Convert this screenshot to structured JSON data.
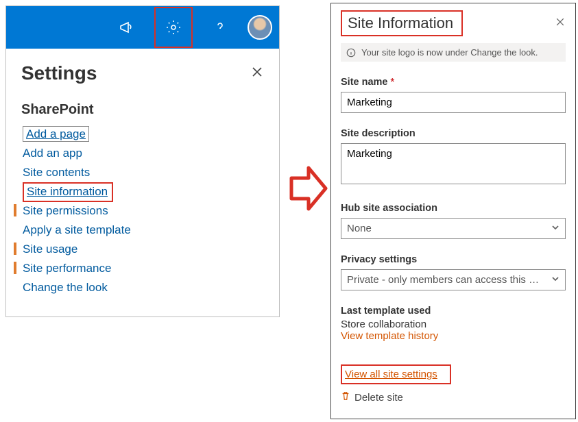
{
  "settings": {
    "title": "Settings",
    "section": "SharePoint",
    "items": [
      {
        "label": "Add a page",
        "boxed": true
      },
      {
        "label": "Add an app"
      },
      {
        "label": "Site contents"
      },
      {
        "label": "Site information",
        "highlight_red": true
      },
      {
        "label": "Site permissions",
        "orange_tick": true
      },
      {
        "label": "Apply a site template"
      },
      {
        "label": "Site usage",
        "orange_tick": true
      },
      {
        "label": "Site performance",
        "orange_tick": true
      },
      {
        "label": "Change the look"
      }
    ]
  },
  "site_info": {
    "title": "Site Information",
    "banner": "Your site logo is now under Change the look.",
    "site_name_label": "Site name",
    "site_name_value": "Marketing",
    "site_desc_label": "Site description",
    "site_desc_value": "Marketing",
    "hub_label": "Hub site association",
    "hub_value": "None",
    "privacy_label": "Privacy settings",
    "privacy_value": "Private - only members can access this …",
    "template_label": "Last template used",
    "template_value": "Store collaboration",
    "template_history": "View template history",
    "view_all": "View all site settings",
    "delete": "Delete site"
  }
}
